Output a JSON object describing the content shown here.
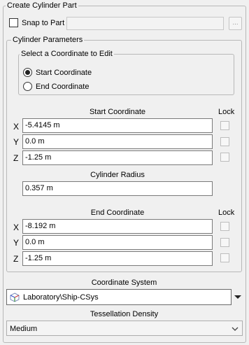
{
  "panel": {
    "title": "Create Cylinder Part"
  },
  "snap": {
    "label": "Snap to Part",
    "value": "",
    "browse_label": "..."
  },
  "cylinder_params": {
    "title": "Cylinder Parameters",
    "select_group": {
      "title": "Select a Coordinate to Edit",
      "options": [
        "Start Coordinate",
        "End Coordinate"
      ],
      "selected": "Start Coordinate"
    },
    "lock_header": "Lock",
    "start": {
      "title": "Start Coordinate",
      "rows": [
        {
          "axis": "X",
          "value": "-5.4145 m"
        },
        {
          "axis": "Y",
          "value": "0.0 m"
        },
        {
          "axis": "Z",
          "value": "-1.25 m"
        }
      ]
    },
    "radius": {
      "title": "Cylinder Radius",
      "value": "0.357 m"
    },
    "end": {
      "title": "End Coordinate",
      "rows": [
        {
          "axis": "X",
          "value": "-8.192 m"
        },
        {
          "axis": "Y",
          "value": "0.0 m"
        },
        {
          "axis": "Z",
          "value": "-1.25 m"
        }
      ]
    }
  },
  "coordinate_system": {
    "title": "Coordinate System",
    "value": "Laboratory\\Ship-CSys",
    "icon": "coordinate-axes-icon"
  },
  "tessellation": {
    "title": "Tessellation Density",
    "value": "Medium"
  },
  "colors": {
    "background": "#f0f0f0",
    "border": "#b8b8b8"
  }
}
